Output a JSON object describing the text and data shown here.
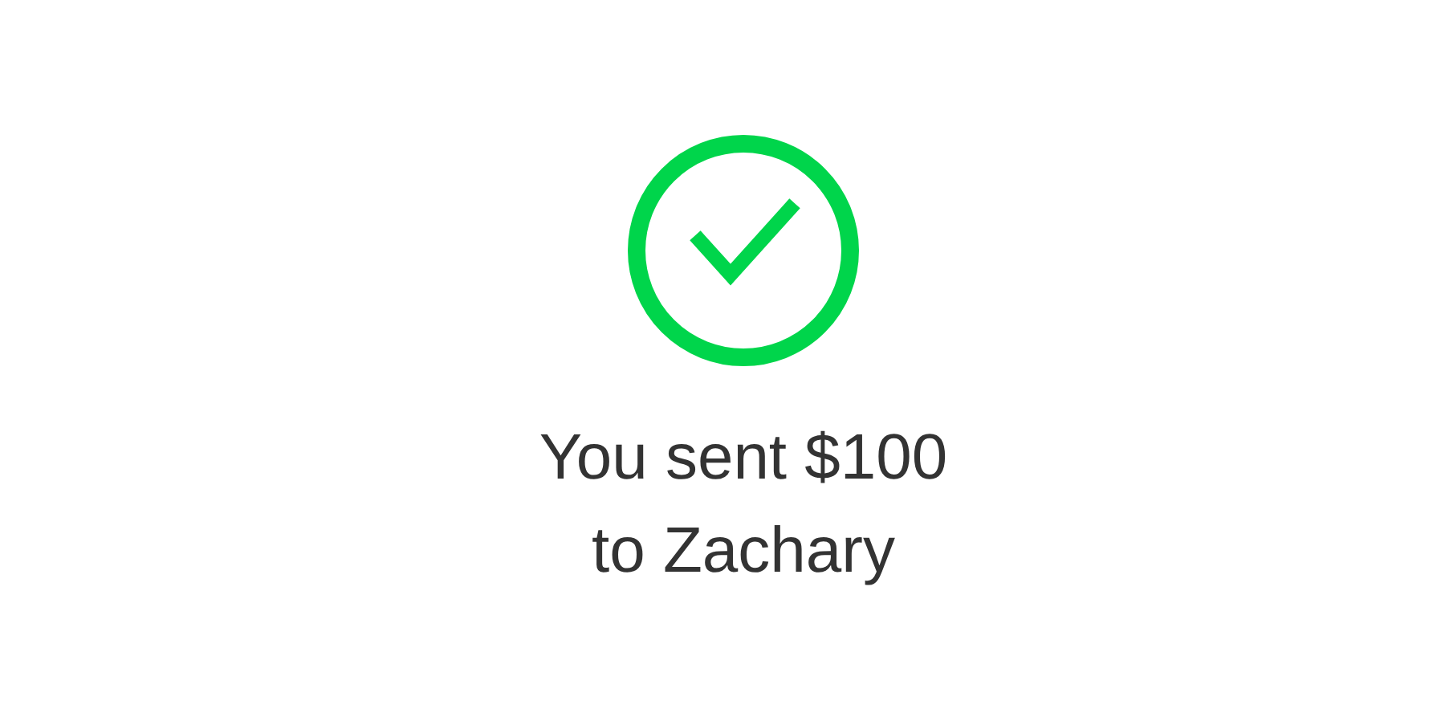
{
  "result": {
    "kind": "success"
  },
  "message": "You sent $100 to Zachary"
}
